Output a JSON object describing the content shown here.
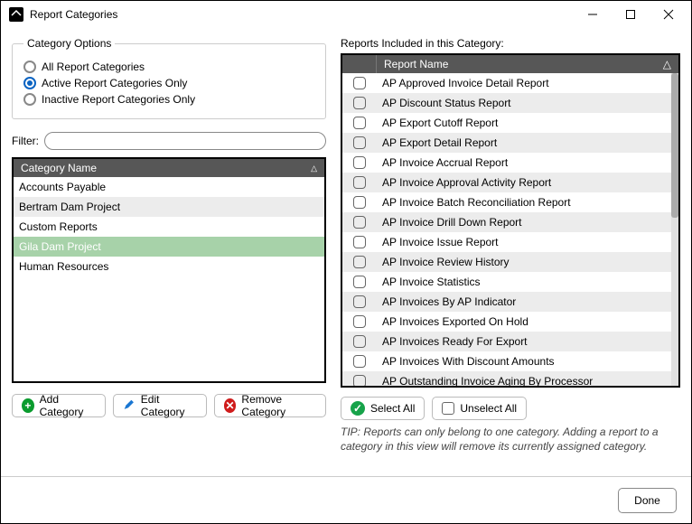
{
  "window": {
    "title": "Report Categories"
  },
  "groupbox": {
    "legend": "Category Options",
    "options": [
      {
        "label": "All Report Categories",
        "selected": false
      },
      {
        "label": "Active Report Categories Only",
        "selected": true
      },
      {
        "label": "Inactive Report Categories Only",
        "selected": false
      }
    ]
  },
  "filter": {
    "label": "Filter:",
    "value": ""
  },
  "category_list": {
    "header": "Category Name",
    "sort_indicator": "△",
    "rows": [
      {
        "name": "Accounts Payable",
        "selected": false
      },
      {
        "name": "Bertram Dam Project",
        "selected": false
      },
      {
        "name": "Custom Reports",
        "selected": false
      },
      {
        "name": "Gila Dam Project",
        "selected": true
      },
      {
        "name": "Human Resources",
        "selected": false
      }
    ]
  },
  "buttons": {
    "add": "Add Category",
    "edit": "Edit Category",
    "remove": "Remove Category",
    "select_all": "Select All",
    "unselect_all": "Unselect All",
    "done": "Done"
  },
  "reports": {
    "header_label": "Reports Included in this Category:",
    "column_header": "Report Name",
    "sort_indicator": "△",
    "rows": [
      "AP Approved Invoice Detail Report",
      "AP Discount Status Report",
      "AP Export Cutoff Report",
      "AP Export Detail Report",
      "AP Invoice Accrual Report",
      "AP Invoice Approval Activity Report",
      "AP Invoice Batch Reconciliation Report",
      "AP Invoice Drill Down Report",
      "AP Invoice Issue Report",
      "AP Invoice Review History",
      "AP Invoice Statistics",
      "AP Invoices By AP Indicator",
      "AP Invoices Exported On Hold",
      "AP Invoices Ready For Export",
      "AP Invoices With Discount Amounts",
      "AP Outstanding Invoice Aging By Processor"
    ]
  },
  "tip": "TIP:  Reports can only belong to one category.  Adding a report to a category in this view will remove its currently assigned category."
}
